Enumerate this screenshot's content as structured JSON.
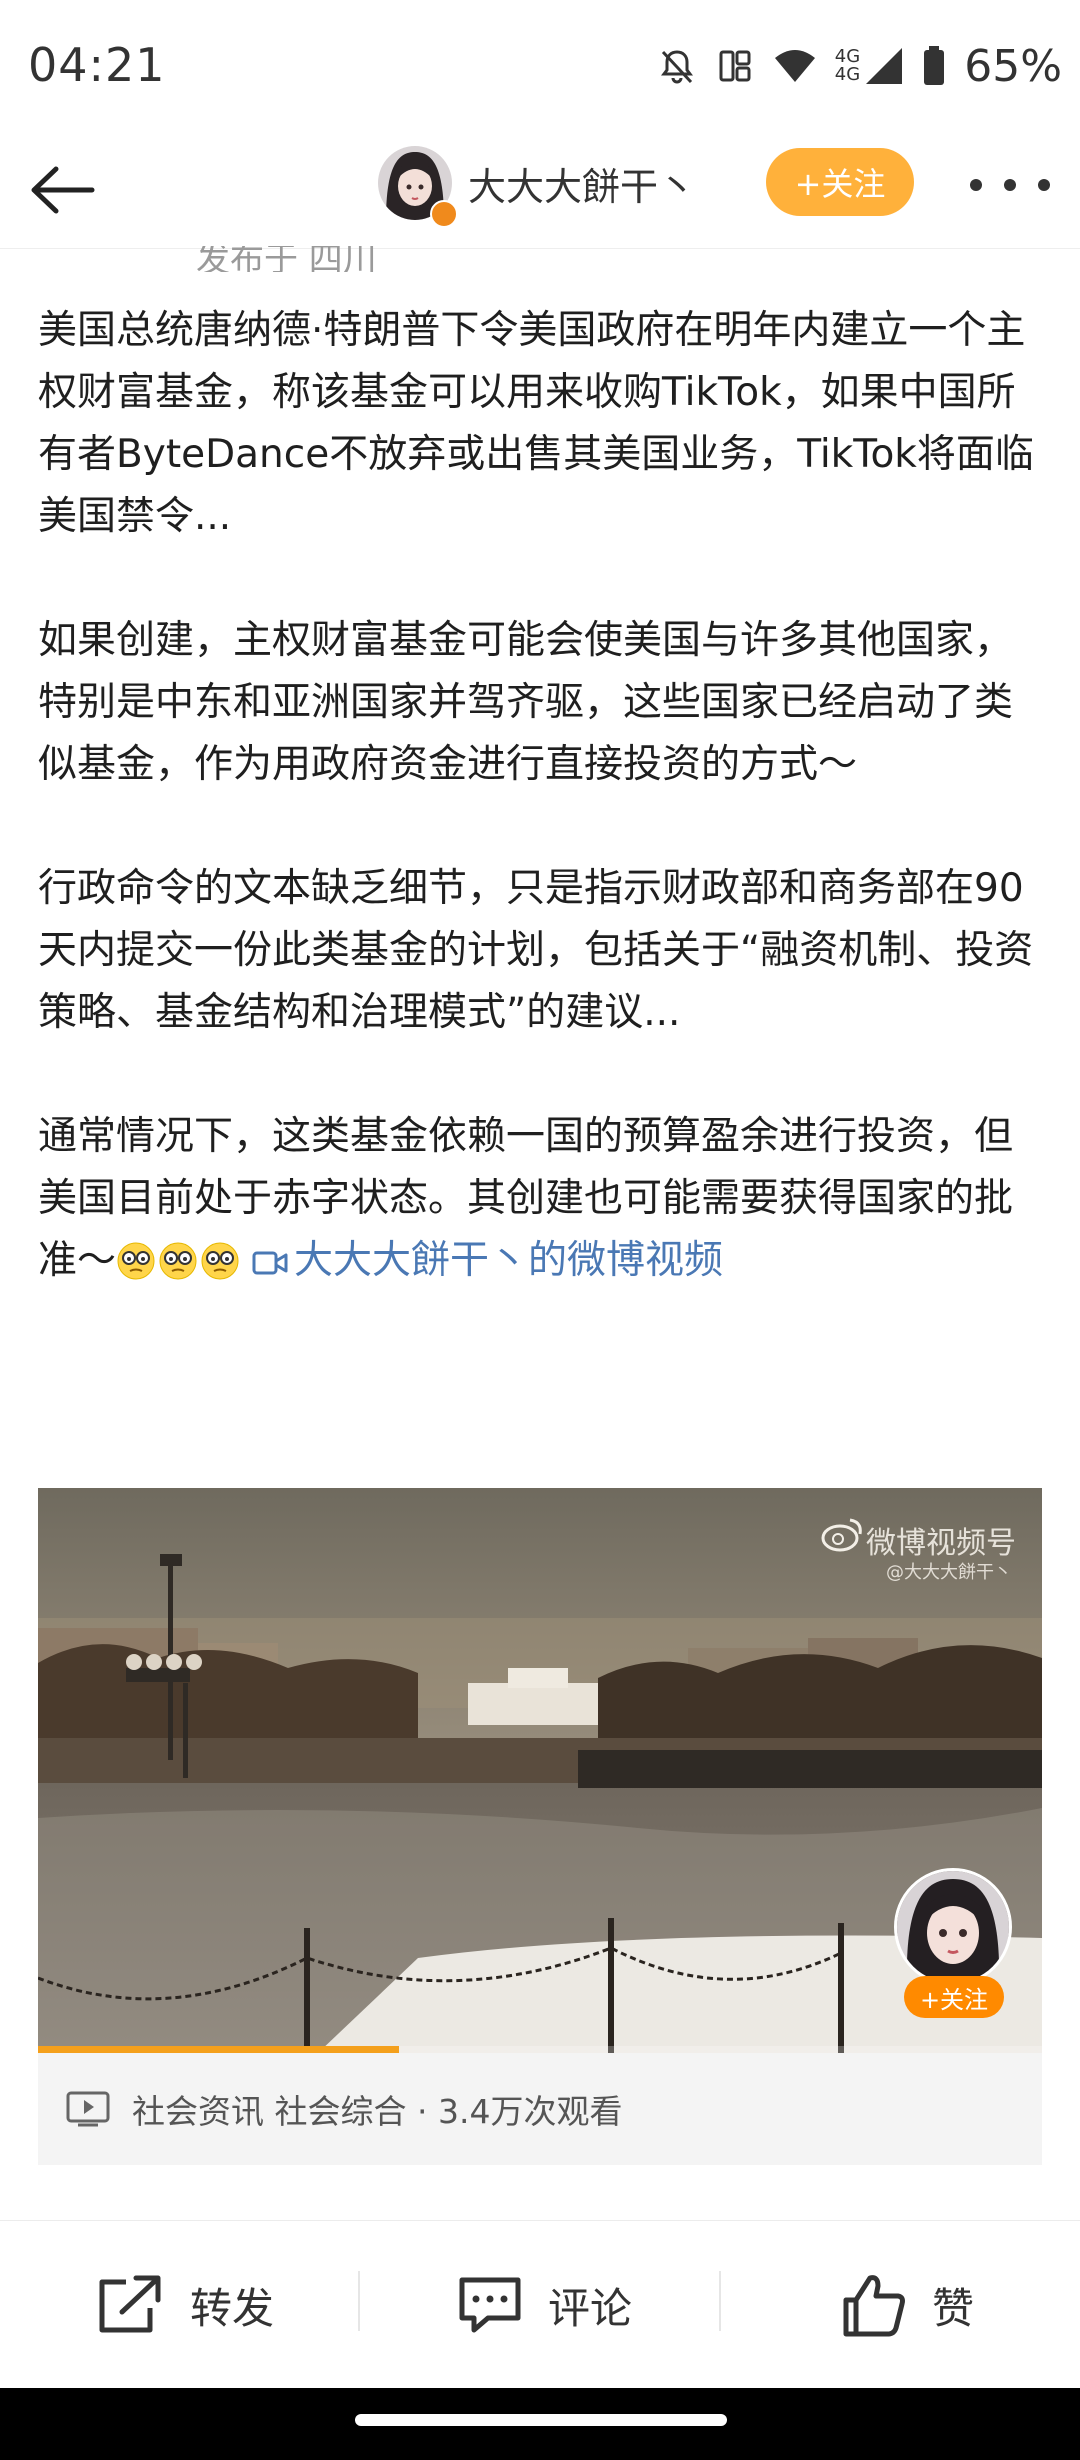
{
  "status_bar": {
    "time": "04:21",
    "network": "4G",
    "battery": "65%"
  },
  "header": {
    "username": "大大大餅干丶",
    "follow_label": "+关注"
  },
  "post": {
    "posted_from": "发布于 四川",
    "paragraphs": [
      "美国总统唐纳德·特朗普下令美国政府在明年内建立一个主权财富基金，称该基金可以用来收购TikTok，如果中国所有者ByteDance不放弃或出售其美国业务，TikTok将面临美国禁令...",
      "如果创建，主权财富基金可能会使美国与许多其他国家，特别是中东和亚洲国家并驾齐驱，这些国家已经启动了类似基金，作为用政府资金进行直接投资的方式～",
      "行政命令的文本缺乏细节，只是指示财政部和商务部在90天内提交一份此类基金的计划，包括关于“融资机制、投资策略、基金结构和治理模式”的建议..."
    ],
    "last_paragraph": "通常情况下，这类基金依赖一国的预算盈余进行投资，但美国目前处于赤字状态。其创建也可能需要获得国家的批准～",
    "video_link": "大大大餅干丶的微博视频"
  },
  "video": {
    "watermark_title": "微博视频号",
    "watermark_sub": "@大大大餅干丶",
    "follow_label": "+关注",
    "progress": 0.36,
    "meta": "社会资讯 社会综合 · 3.4万次观看"
  },
  "actions": {
    "repost": "转发",
    "comment": "评论",
    "like": "赞"
  }
}
